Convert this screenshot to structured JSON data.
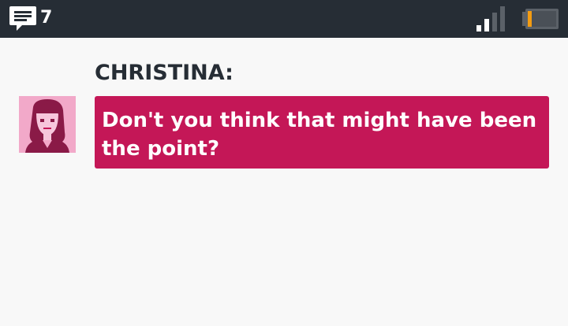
{
  "status_bar": {
    "message_icon": "speech-bubble-icon",
    "message_count": "7",
    "signal_icon": "signal-strength-icon",
    "battery_icon": "battery-low-icon",
    "background_color": "#262d35",
    "battery_level_color": "#f39c12"
  },
  "conversation": {
    "speaker_label": "CHRISTINA:",
    "avatar_icon": "christina-portrait-icon",
    "message_text": "Don't you think that might have been the point?",
    "bubble_color": "#c41757"
  }
}
